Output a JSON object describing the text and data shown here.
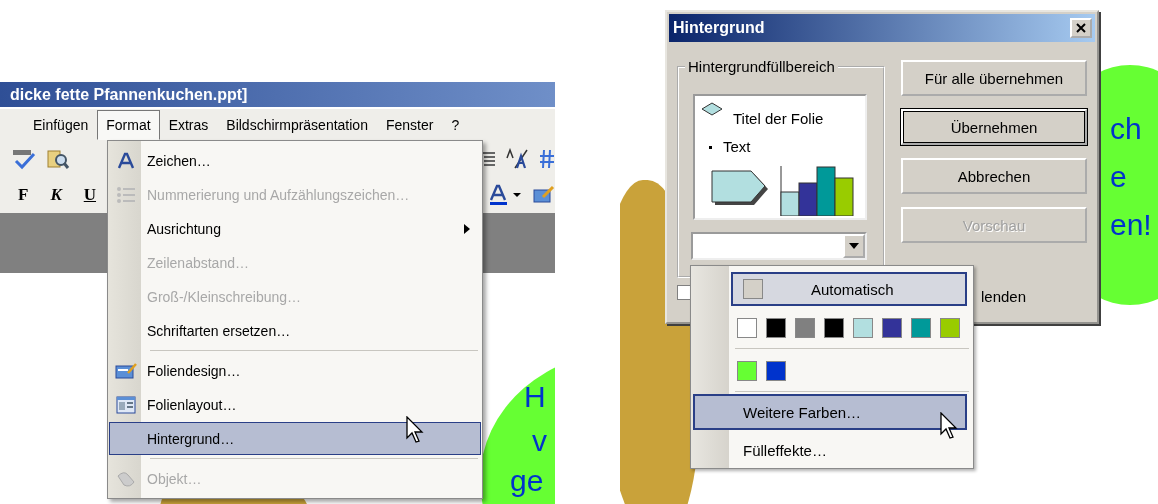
{
  "left": {
    "window": {
      "title": "dicke fette Pfannenkuchen.ppt]"
    },
    "menubar": [
      {
        "label": "Einfügen",
        "selected": false
      },
      {
        "label": "Format",
        "selected": true
      },
      {
        "label": "Extras",
        "selected": false
      },
      {
        "label": "Bildschirmpräsentation",
        "selected": false
      },
      {
        "label": "Fenster",
        "selected": false
      },
      {
        "label": "?",
        "selected": false
      }
    ],
    "format_buttons": [
      "F",
      "K",
      "U"
    ],
    "format_menu": {
      "items": [
        {
          "label": "Zeichen…",
          "disabled": false,
          "selected": false,
          "submenu": false,
          "separator_before": false
        },
        {
          "label": "Nummerierung und Aufzählungszeichen…",
          "disabled": true,
          "selected": false,
          "submenu": false,
          "separator_before": false
        },
        {
          "label": "Ausrichtung",
          "disabled": false,
          "selected": false,
          "submenu": true,
          "separator_before": false
        },
        {
          "label": "Zeilenabstand…",
          "disabled": true,
          "selected": false,
          "submenu": false,
          "separator_before": false
        },
        {
          "label": "Groß-/Kleinschreibung…",
          "disabled": true,
          "selected": false,
          "submenu": false,
          "separator_before": false
        },
        {
          "label": "Schriftarten ersetzen…",
          "disabled": false,
          "selected": false,
          "submenu": false,
          "separator_before": false
        },
        {
          "label": "Foliendesign…",
          "disabled": false,
          "selected": false,
          "submenu": false,
          "separator_before": true
        },
        {
          "label": "Folienlayout…",
          "disabled": false,
          "selected": false,
          "submenu": false,
          "separator_before": false
        },
        {
          "label": "Hintergrund…",
          "disabled": false,
          "selected": true,
          "submenu": false,
          "separator_before": false
        },
        {
          "label": "Objekt…",
          "disabled": true,
          "selected": false,
          "submenu": false,
          "separator_before": true
        }
      ]
    },
    "slide_text": [
      "H",
      "v",
      "ge"
    ]
  },
  "right": {
    "dialog": {
      "title": "Hintergrund",
      "group_label": "Hintergrundfüllbereich",
      "preview": {
        "title": "Titel der Folie",
        "bullet": "Text"
      },
      "buttons": [
        {
          "label": "Für alle übernehmen",
          "default": false,
          "disabled": false
        },
        {
          "label": "Übernehmen",
          "default": true,
          "disabled": false
        },
        {
          "label": "Abbrechen",
          "default": false,
          "disabled": false
        },
        {
          "label": "Vorschau",
          "default": false,
          "disabled": true
        }
      ],
      "checkbox": {
        "label": "lenden",
        "checked": false
      }
    },
    "color_menu": {
      "automatic": "Automatisch",
      "colors": [
        {
          "color": "#ffffff"
        },
        {
          "color": "#000000"
        },
        {
          "color": "#808080"
        },
        {
          "color": "#000000"
        },
        {
          "color": "#b2dfe0"
        },
        {
          "color": "#333399"
        },
        {
          "color": "#009999"
        },
        {
          "color": "#99cc00"
        }
      ],
      "recent_colors": [
        {
          "color": "#66ff33"
        },
        {
          "color": "#0033cc"
        }
      ],
      "items": [
        {
          "label": "Weitere Farben…",
          "selected": true
        },
        {
          "label": "Fülleffekte…",
          "selected": false
        }
      ]
    },
    "slide_text": [
      "ch",
      "e",
      "en!"
    ]
  }
}
